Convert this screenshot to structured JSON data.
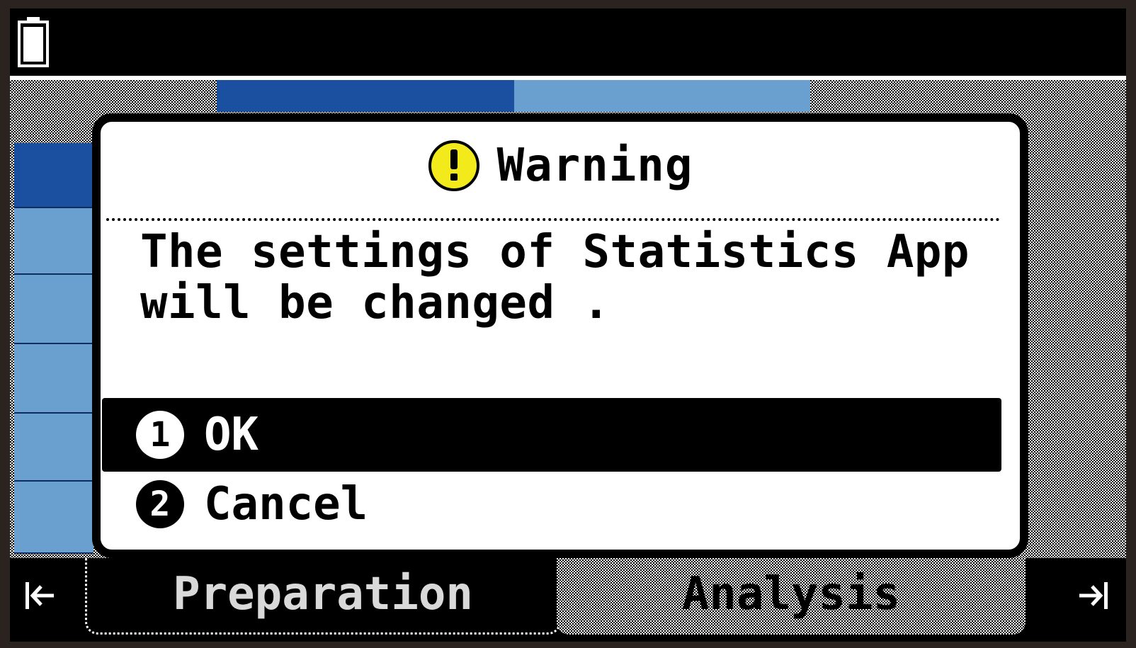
{
  "status_bar": {
    "battery_icon": "battery-full-icon"
  },
  "dialog": {
    "title": "Warning",
    "icon": "warning-exclamation-icon",
    "icon_color": "#f2ea1a",
    "message": "The settings of Statistics App\nwill be changed .",
    "options": [
      {
        "number": "1",
        "label": "OK",
        "selected": true
      },
      {
        "number": "2",
        "label": "Cancel",
        "selected": false
      }
    ]
  },
  "bottom_tabs": {
    "left_arrow_icon": "jump-to-start-icon",
    "right_arrow_icon": "jump-to-end-icon",
    "tabs": [
      {
        "label": "Preparation",
        "active": false
      },
      {
        "label": "Analysis",
        "active": true
      }
    ]
  },
  "colors": {
    "accent_dark_blue": "#1b4fa0",
    "accent_light_blue": "#6aa0cf"
  }
}
